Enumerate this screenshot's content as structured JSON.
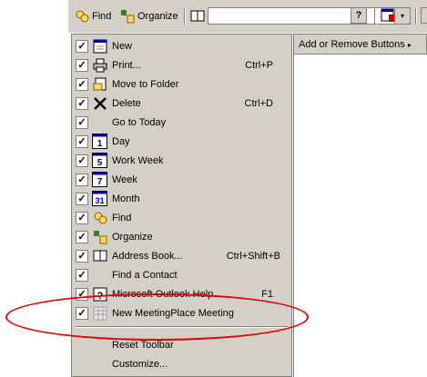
{
  "toolbar": {
    "find_label": "Find",
    "organize_label": "Organize",
    "combo_value": "",
    "dropdown_glyph": "▾",
    "add_remove_label": "Add or Remove Buttons",
    "help_glyph": "?"
  },
  "menu": {
    "items": [
      {
        "label": "New",
        "shortcut": "",
        "checked": true,
        "icon": "new-icon"
      },
      {
        "label": "Print...",
        "shortcut": "Ctrl+P",
        "checked": true,
        "icon": "print-icon"
      },
      {
        "label": "Move to Folder",
        "shortcut": "",
        "checked": true,
        "icon": "move-folder-icon"
      },
      {
        "label": "Delete",
        "shortcut": "Ctrl+D",
        "checked": true,
        "icon": "delete-icon"
      },
      {
        "label": "Go to Today",
        "shortcut": "",
        "checked": true,
        "icon": ""
      },
      {
        "label": "Day",
        "shortcut": "",
        "checked": true,
        "icon": "day-icon",
        "num": "1"
      },
      {
        "label": "Work Week",
        "shortcut": "",
        "checked": true,
        "icon": "work-week-icon",
        "num": "5"
      },
      {
        "label": "Week",
        "shortcut": "",
        "checked": true,
        "icon": "week-icon",
        "num": "7"
      },
      {
        "label": "Month",
        "shortcut": "",
        "checked": true,
        "icon": "month-icon",
        "num": "31"
      },
      {
        "label": "Find",
        "shortcut": "",
        "checked": true,
        "icon": "find-icon"
      },
      {
        "label": "Organize",
        "shortcut": "",
        "checked": true,
        "icon": "organize-icon"
      },
      {
        "label": "Address Book...",
        "shortcut": "Ctrl+Shift+B",
        "checked": true,
        "icon": "address-book-icon"
      },
      {
        "label": "Find a Contact",
        "shortcut": "",
        "checked": true,
        "icon": ""
      },
      {
        "label": "Microsoft Outlook Help",
        "shortcut": "F1",
        "checked": true,
        "icon": "help-icon"
      },
      {
        "label": "New MeetingPlace Meeting",
        "shortcut": "",
        "checked": true,
        "icon": "meetingplace-icon"
      }
    ],
    "reset_label": "Reset Toolbar",
    "customize_label": "Customize..."
  },
  "colors": {
    "face": "#d4d0c8",
    "annotation": "#e00000"
  }
}
